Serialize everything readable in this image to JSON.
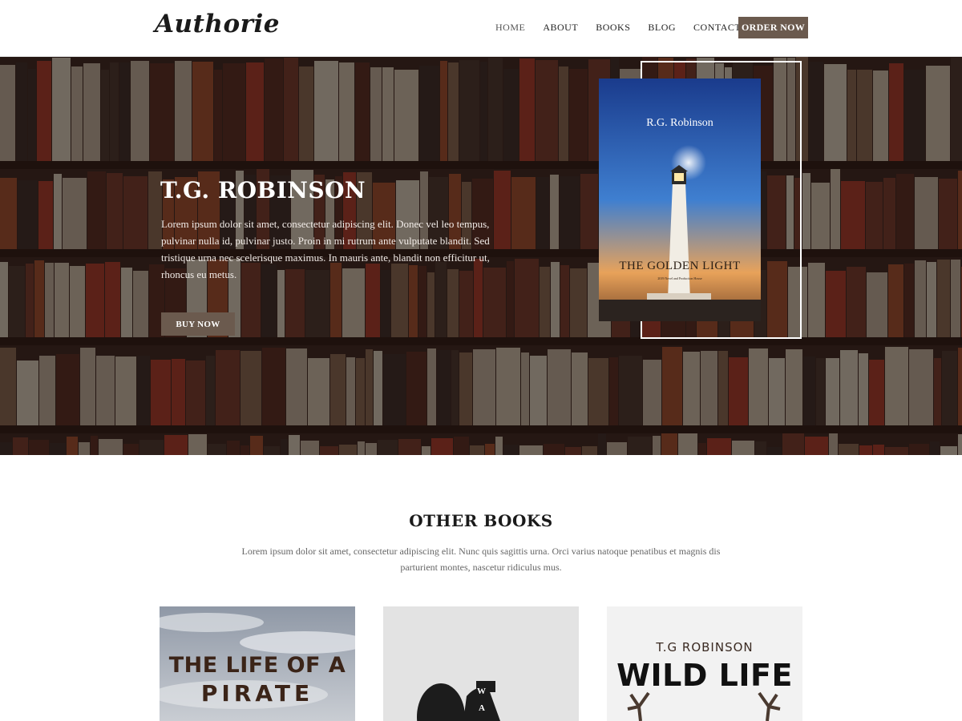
{
  "header": {
    "logo": "Authorie",
    "nav": [
      "HOME",
      "ABOUT",
      "BOOKS",
      "BLOG",
      "CONTACT"
    ],
    "cta_label": "ORDER NOW"
  },
  "hero": {
    "title": "T.G. ROBINSON",
    "text": "Lorem ipsum dolor sit amet, consectetur adipiscing elit. Donec vel leo tempus, pulvinar nulla id, pulvinar justo. Proin in mi rutrum ante vulputate blandit. Sed tristique urna nec scelerisque maximus. In mauris ante, blandit non efficitur ut, rhoncus eu metus.",
    "button_label": "BUY NOW",
    "cover": {
      "author": "R.G. Robinson",
      "title": "THE GOLDEN LIGHT",
      "subtitle": "2019 Novel and Production House"
    }
  },
  "other_books": {
    "title": "OTHER BOOKS",
    "text": "Lorem ipsum dolor sit amet, consectetur adipiscing elit. Nunc quis sagittis urna. Orci varius natoque penatibus et magnis dis parturient montes, nascetur ridiculus mus.",
    "books": [
      {
        "line1": "THE LIFE OF A",
        "line2": "PIRATE"
      },
      {
        "letter1": "W",
        "letter2": "A"
      },
      {
        "author": "T.G ROBINSON",
        "title": "WILD LIFE"
      }
    ]
  },
  "colors": {
    "accent": "#6b5a4e",
    "dark_text": "#1a1a1a"
  }
}
